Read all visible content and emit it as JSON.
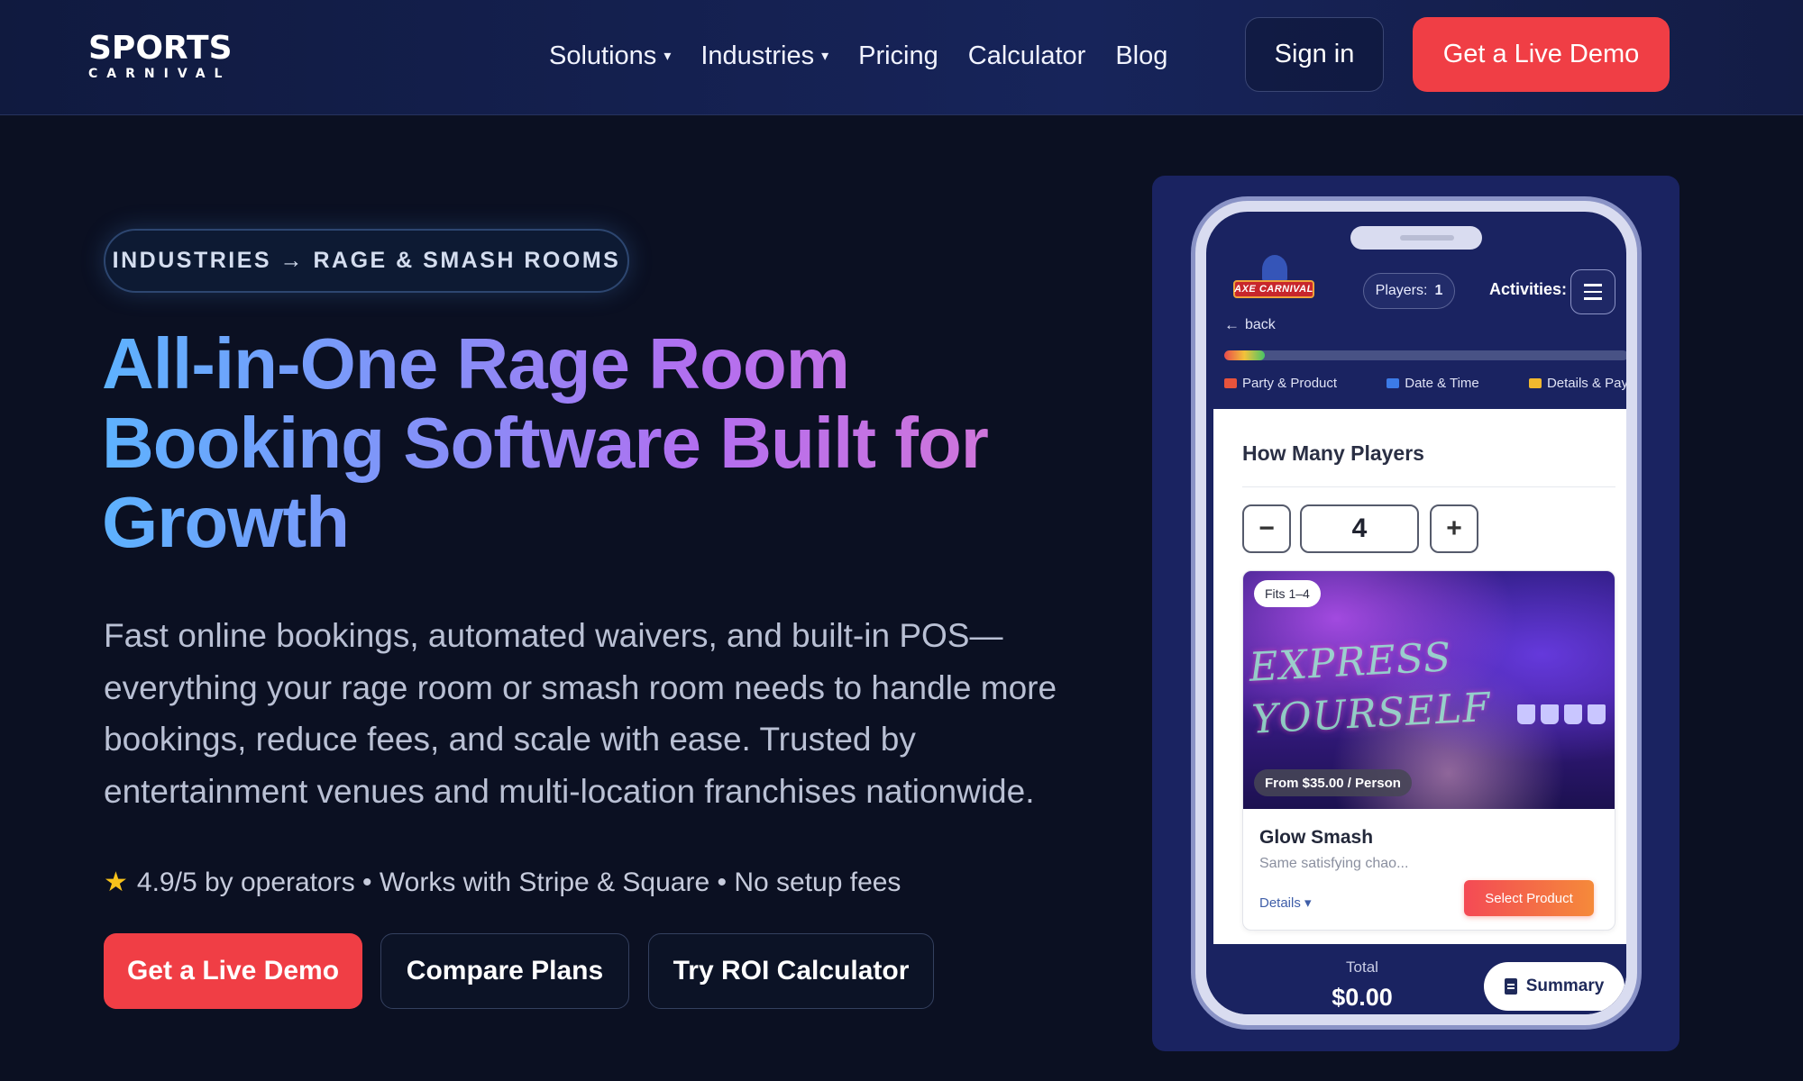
{
  "brand": {
    "name": "SPORTS",
    "sub": "CARNIVAL"
  },
  "nav": {
    "items": [
      {
        "label": "Solutions",
        "caret": "▾"
      },
      {
        "label": "Industries",
        "caret": "▾"
      },
      {
        "label": "Pricing"
      },
      {
        "label": "Calculator"
      },
      {
        "label": "Blog"
      }
    ],
    "signin": "Sign in",
    "demo": "Get a Live Demo"
  },
  "hero": {
    "breadcrumb": "INDUSTRIES → RAGE & SMASH ROOMS",
    "title": "All-in-One Rage Room Booking Software Built for Growth",
    "subtitle": "Fast online bookings, automated waivers, and built-in POS—everything your rage room or smash room needs to handle more bookings, reduce fees, and scale with ease. Trusted by entertainment venues and multi-location franchises nationwide.",
    "meta": "4.9/5 by operators • Works with Stripe & Square • No setup fees",
    "cta_primary": "Get a Live Demo",
    "cta_compare": "Compare Plans",
    "cta_roi": "Try ROI Calculator"
  },
  "phone": {
    "app_logo": "AXE CARNIVAL",
    "players_label": "Players:",
    "players_count": "1",
    "activities_label": "Activities:",
    "back_label": "back",
    "progress": 0.1,
    "steps": [
      "Party & Product",
      "Date & Time",
      "Details & Pay"
    ],
    "question": "How Many Players",
    "stepper_value": "4",
    "product": {
      "fits": "Fits 1–4",
      "image_text": "EXPRESS YOURSELF",
      "price": "From $35.00 / Person",
      "name": "Glow Smash",
      "description": "Same satisfying chao...",
      "details": "Details ▾",
      "select": "Select Product"
    },
    "total_label": "Total",
    "total_value": "$0.00",
    "summary": "Summary"
  },
  "colors": {
    "accent": "#f03e45",
    "navy": "#1a2361",
    "background": "#0b1022"
  }
}
